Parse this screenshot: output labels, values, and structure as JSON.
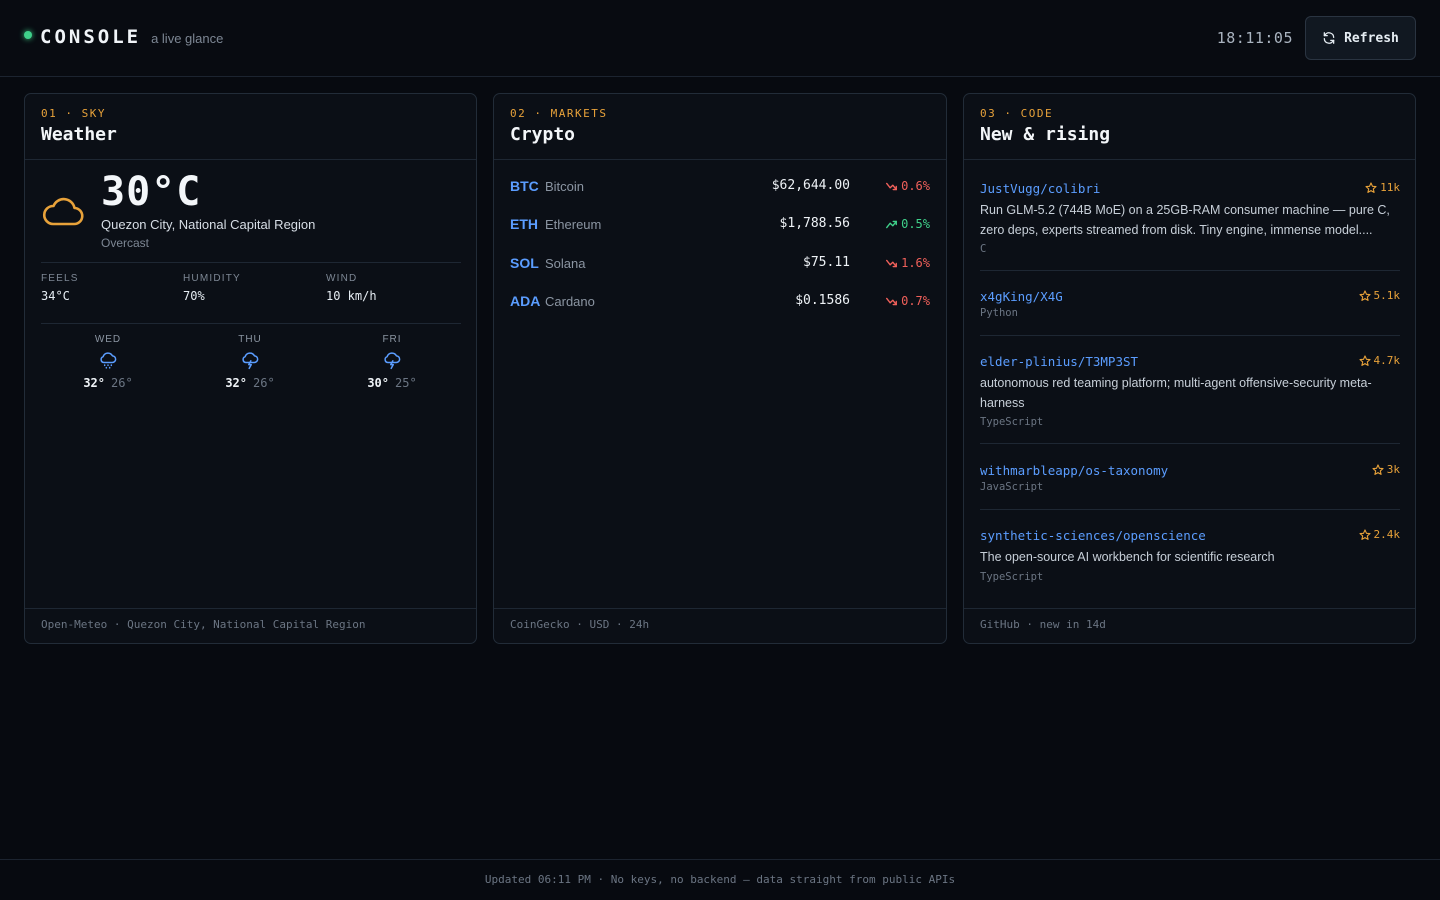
{
  "header": {
    "brand": "CONSOLE",
    "tagline": "a live glance",
    "clock": "18:11:05",
    "refresh_label": "Refresh",
    "status_color": "#3fd08a"
  },
  "weather": {
    "kicker": "01 · SKY",
    "title": "Weather",
    "temp": "30°C",
    "location": "Quezon City, National Capital Region",
    "condition": "Overcast",
    "stats": [
      {
        "label": "FEELS",
        "value": "34°C"
      },
      {
        "label": "HUMIDITY",
        "value": "70%"
      },
      {
        "label": "WIND",
        "value": "10 km/h"
      }
    ],
    "forecast": [
      {
        "day": "WED",
        "icon": "drizzle-icon",
        "hi": "32°",
        "lo": "26°"
      },
      {
        "day": "THU",
        "icon": "thunderstorm-icon",
        "hi": "32°",
        "lo": "26°"
      },
      {
        "day": "FRI",
        "icon": "thunderstorm-icon",
        "hi": "30°",
        "lo": "25°"
      }
    ],
    "footer": "Open-Meteo · Quezon City, National Capital Region"
  },
  "crypto": {
    "kicker": "02 · MARKETS",
    "title": "Crypto",
    "rows": [
      {
        "symbol": "BTC",
        "name": "Bitcoin",
        "price": "$62,644.00",
        "change": "0.6%",
        "direction": "down"
      },
      {
        "symbol": "ETH",
        "name": "Ethereum",
        "price": "$1,788.56",
        "change": "0.5%",
        "direction": "up"
      },
      {
        "symbol": "SOL",
        "name": "Solana",
        "price": "$75.11",
        "change": "1.6%",
        "direction": "down"
      },
      {
        "symbol": "ADA",
        "name": "Cardano",
        "price": "$0.1586",
        "change": "0.7%",
        "direction": "down"
      }
    ],
    "colors": {
      "up": "#3fd08a",
      "down": "#f0605a"
    },
    "footer": "CoinGecko · USD · 24h"
  },
  "code": {
    "kicker": "03 · CODE",
    "title": "New & rising",
    "repos": [
      {
        "name": "JustVugg/colibri",
        "stars": "11k",
        "description": "Run GLM-5.2 (744B MoE) on a 25GB-RAM consumer machine — pure C, zero deps, experts streamed from disk. Tiny engine, immense model....",
        "language": "C"
      },
      {
        "name": "x4gKing/X4G",
        "stars": "5.1k",
        "description": "",
        "language": "Python"
      },
      {
        "name": "elder-plinius/T3MP3ST",
        "stars": "4.7k",
        "description": "autonomous red teaming platform; multi-agent offensive-security meta-harness",
        "language": "TypeScript"
      },
      {
        "name": "withmarbleapp/os-taxonomy",
        "stars": "3k",
        "description": "",
        "language": "JavaScript"
      },
      {
        "name": "synthetic-sciences/openscience",
        "stars": "2.4k",
        "description": "The open-source AI workbench for scientific research",
        "language": "TypeScript"
      }
    ],
    "footer": "GitHub · new in 14d"
  },
  "footer": {
    "text": "Updated 06:11 PM · No keys, no backend — data straight from public APIs"
  }
}
